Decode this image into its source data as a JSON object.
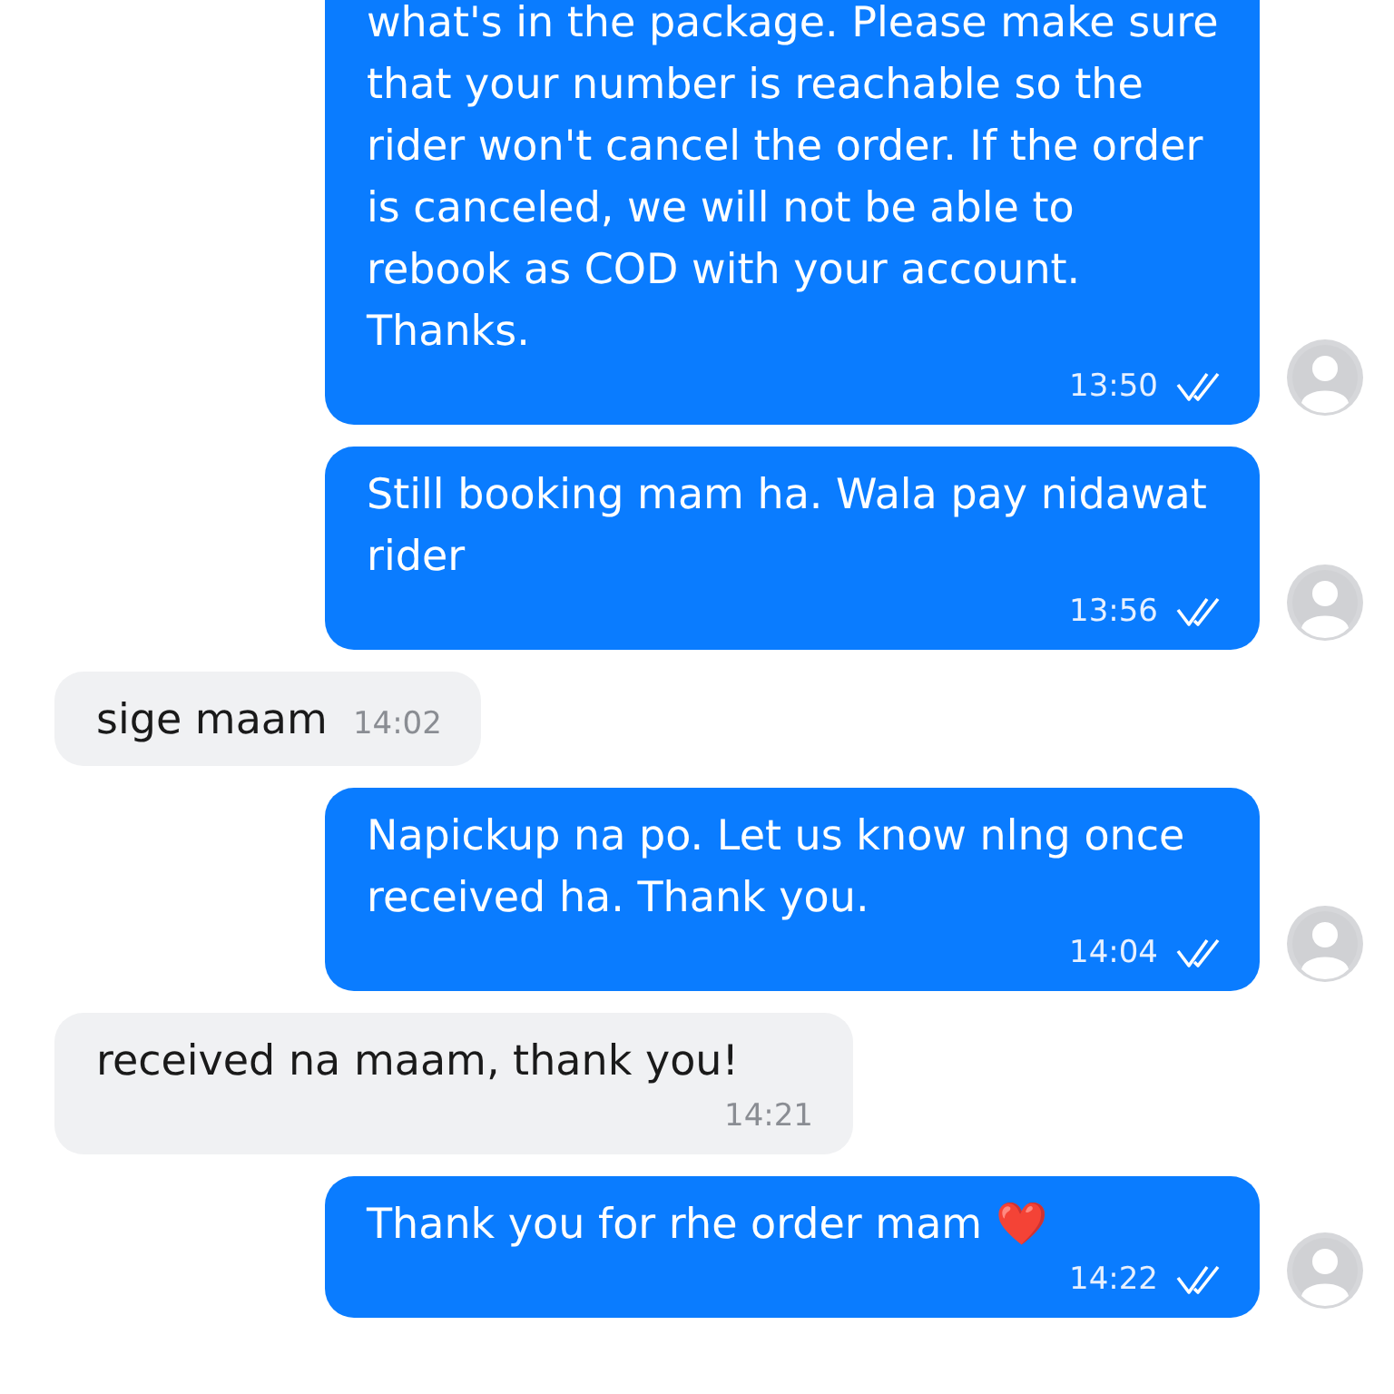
{
  "messages": [
    {
      "kind": "outgoing",
      "text": "what's in the package. Please make sure that your number is reachable so the rider won't cancel the order. If the order is canceled, we will not be able to rebook as COD with your account. Thanks.",
      "time": "13:50"
    },
    {
      "kind": "outgoing",
      "text": "Still booking mam ha. Wala pay nidawat rider",
      "time": "13:56"
    },
    {
      "kind": "incoming",
      "text": "sige maam",
      "time": "14:02"
    },
    {
      "kind": "outgoing",
      "text": "Napickup na po. Let us know nlng once received ha. Thank you.",
      "time": "14:04"
    },
    {
      "kind": "incoming",
      "text": "received na maam, thank you!",
      "time": "14:21"
    },
    {
      "kind": "outgoing",
      "text": "Thank you for rhe order mam ❤️",
      "time": "14:22"
    }
  ]
}
